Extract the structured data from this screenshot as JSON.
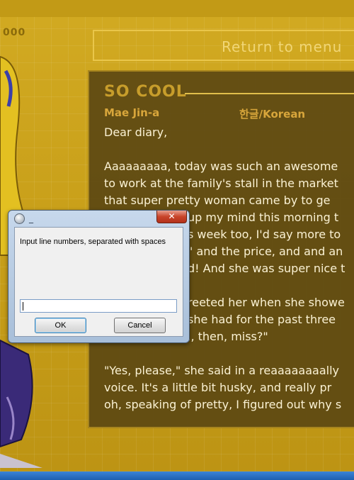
{
  "game": {
    "counter": "000",
    "return_button": "Return to menu",
    "entry": {
      "title": "SO COOL",
      "author": "Mae Jin-a",
      "language": "한글/Korean",
      "lines": [
        "Dear diary,",
        "",
        "Aaaaaaaaa, today was such an awesome",
        "to work at the family's stall in the market",
        "that super pretty woman came by to ge",
        "up my mind this morning t",
        "s week too, I'd say more to",
        "\" and the price, and and an",
        "d! And she was super nice t",
        "",
        "reeted her when she showe",
        " she had for the past three",
        "l, then, miss?\"",
        "",
        "\"Yes, please,\" she said in a reaaaaaaaally",
        "voice. It's a little bit husky, and really pr",
        "oh, speaking of pretty, I figured out why s"
      ]
    }
  },
  "dialog": {
    "minimize_glyph": "_",
    "close_glyph": "✕",
    "prompt": "Input line numbers, separated with spaces",
    "input_value": "",
    "ok_label": "OK",
    "cancel_label": "Cancel"
  },
  "colors": {
    "background_gold": "#c9a21a",
    "panel_brown": "#5c4812",
    "title_gold": "#c79d2b",
    "text_cream": "#fbf2d4",
    "dialog_frame": "#c7d8ec"
  }
}
